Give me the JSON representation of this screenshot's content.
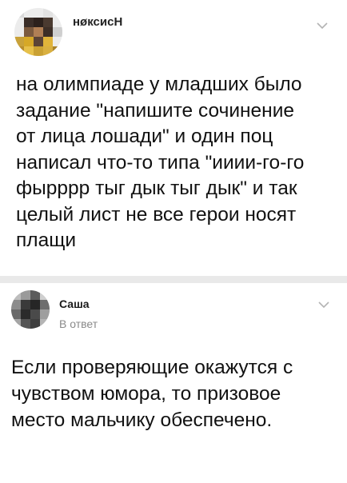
{
  "post": {
    "author": "нøксисН",
    "lines": [
      "на олимпиаде у младших было",
      "задание \"напишите сочинение",
      "от лица лошади\" и один поц",
      "написал что-то типа \"ииии-го-го",
      "фырррр тыг дык тыг дык\" и так",
      "целый лист не все герои носят",
      "плащи"
    ]
  },
  "reply": {
    "author": "Саша",
    "label": "В ответ",
    "lines": [
      "Если проверяющие окажутся с",
      "чувством юмора, то призовое",
      "место мальчику обеспечено."
    ]
  },
  "colors": {
    "divider": "#e9e9e9",
    "muted": "#8a8a8a",
    "chevron": "#b3b3b3"
  },
  "icons": {
    "menu": "chevron-down-icon"
  }
}
